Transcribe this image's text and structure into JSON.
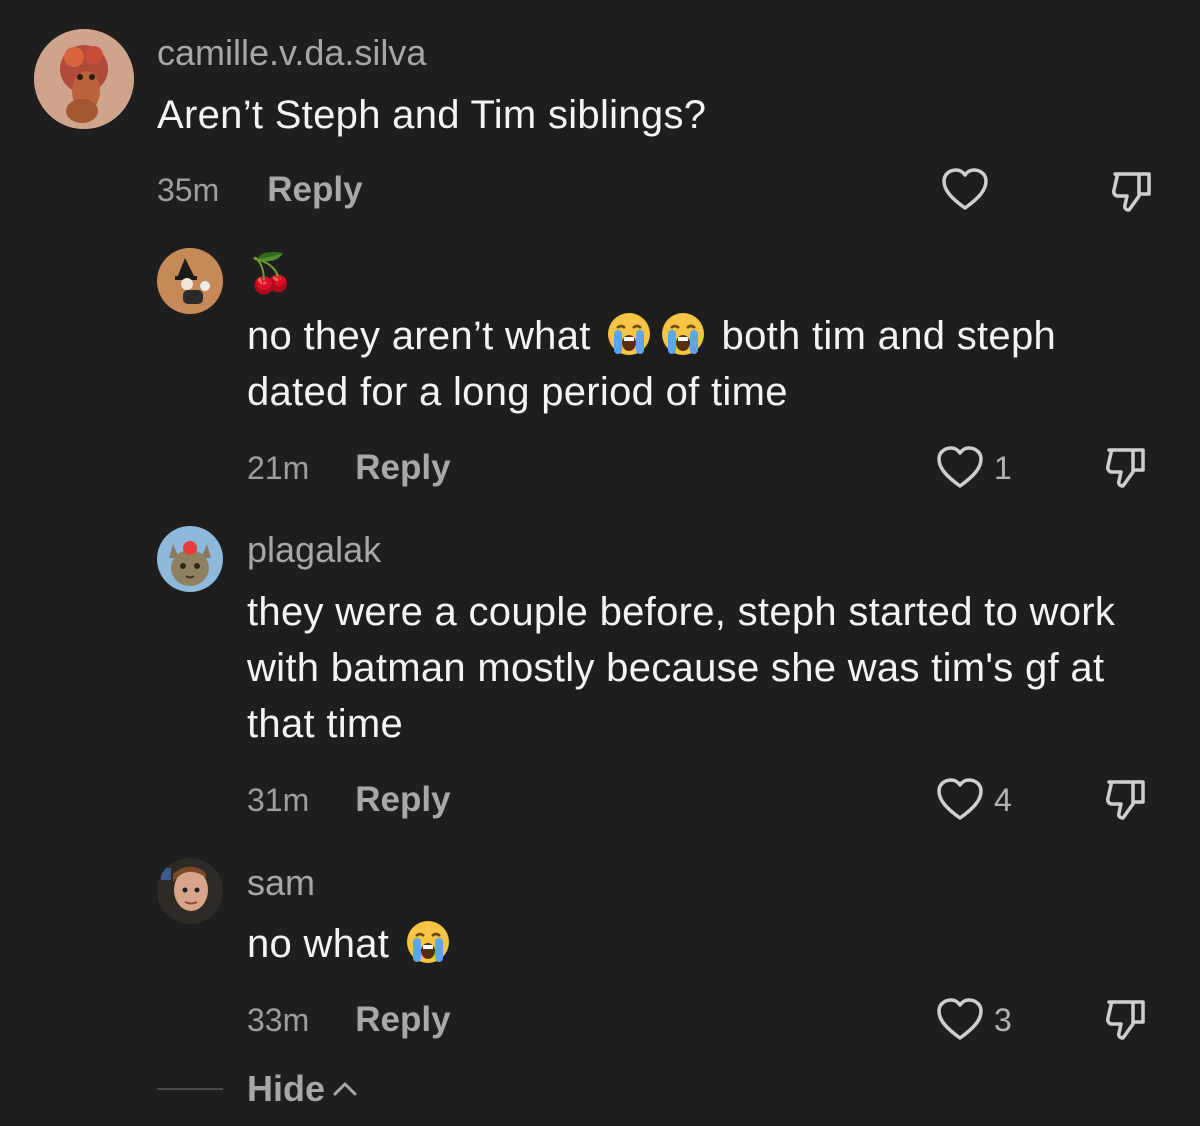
{
  "comments": [
    {
      "username": "camille.v.da.silva",
      "text": "Aren’t Steph and Tim siblings?",
      "time": "35m",
      "reply_label": "Reply",
      "like_count": ""
    },
    {
      "username": "🍒",
      "text_before": "no they aren’t what",
      "text_after": "both tim and steph dated for a long period of time",
      "time": "21m",
      "reply_label": "Reply",
      "like_count": "1"
    },
    {
      "username": "plagalak",
      "text": "they were a couple before, steph started to work with batman mostly because she was tim's gf at that time",
      "time": "31m",
      "reply_label": "Reply",
      "like_count": "4"
    },
    {
      "username": "sam",
      "text": "no what",
      "time": "33m",
      "reply_label": "Reply",
      "like_count": "3"
    }
  ],
  "hide_label": "Hide",
  "icons": {
    "like": "heart-outline-icon",
    "dislike": "thumbs-down-outline-icon",
    "emoji": "loudly-crying-face-emoji",
    "hide": "chevron-up-icon"
  },
  "colors": {
    "background": "#1e1e1e",
    "username": "#a7a7a7",
    "text": "#f4f4f4",
    "muted": "#9e9e9e"
  }
}
